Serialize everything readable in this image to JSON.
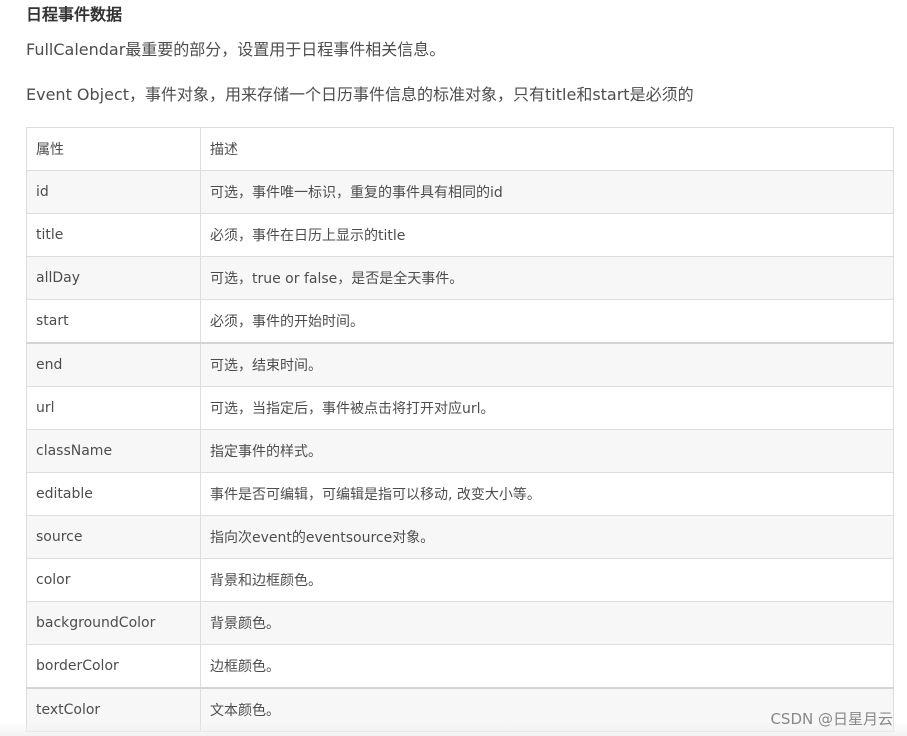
{
  "heading": "日程事件数据",
  "paragraphs": [
    "FullCalendar最重要的部分，设置用于日程事件相关信息。",
    "Event Object，事件对象，用来存储一个日历事件信息的标准对象，只有title和start是必须的"
  ],
  "table": {
    "headers": [
      "属性",
      "描述"
    ],
    "rows": [
      {
        "prop": "id",
        "desc": "可选，事件唯一标识，重复的事件具有相同的id"
      },
      {
        "prop": "title",
        "desc": "必须，事件在日历上显示的title"
      },
      {
        "prop": "allDay",
        "desc": "可选，true or false，是否是全天事件。"
      },
      {
        "prop": "start",
        "desc": "必须，事件的开始时间。"
      },
      {
        "prop": "end",
        "desc": "可选，结束时间。"
      },
      {
        "prop": "url",
        "desc": "可选，当指定后，事件被点击将打开对应url。"
      },
      {
        "prop": "className",
        "desc": "指定事件的样式。"
      },
      {
        "prop": "editable",
        "desc": "事件是否可编辑，可编辑是指可以移动, 改变大小等。"
      },
      {
        "prop": "source",
        "desc": "指向次event的eventsource对象。"
      },
      {
        "prop": "color",
        "desc": "背景和边框颜色。"
      },
      {
        "prop": "backgroundColor",
        "desc": "背景颜色。"
      },
      {
        "prop": "borderColor",
        "desc": "边框颜色。"
      },
      {
        "prop": "textColor",
        "desc": "文本颜色。"
      }
    ]
  },
  "watermark": "CSDN @日星月云"
}
